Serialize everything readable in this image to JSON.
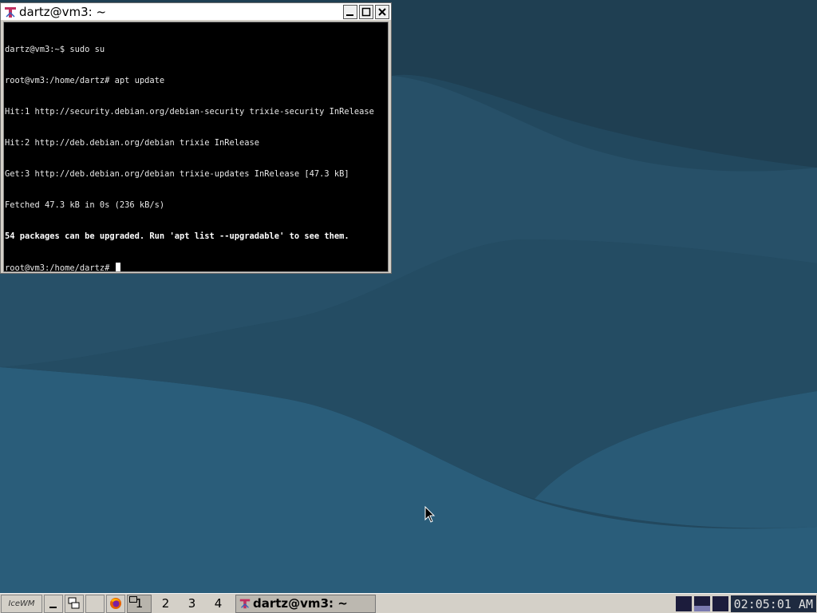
{
  "window": {
    "title": "dartz@vm3: ~"
  },
  "terminal": {
    "lines": [
      {
        "text": "dartz@vm3:~$ sudo su",
        "bold": false
      },
      {
        "text": "root@vm3:/home/dartz# apt update",
        "bold": false
      },
      {
        "text": "Hit:1 http://security.debian.org/debian-security trixie-security InRelease",
        "bold": false
      },
      {
        "text": "Hit:2 http://deb.debian.org/debian trixie InRelease",
        "bold": false
      },
      {
        "text": "Get:3 http://deb.debian.org/debian trixie-updates InRelease [47.3 kB]",
        "bold": false
      },
      {
        "text": "Fetched 47.3 kB in 0s (236 kB/s)",
        "bold": false
      },
      {
        "text": "54 packages can be upgraded. Run 'apt list --upgradable' to see them.",
        "bold": true
      }
    ],
    "prompt": "root@vm3:/home/dartz# "
  },
  "taskbar": {
    "start_label": "IceWM",
    "workspaces": [
      "1",
      "2",
      "3",
      "4"
    ],
    "active_workspace": "1",
    "task_label": "dartz@vm3: ~",
    "clock": "02:05:01 AM",
    "cpu_levels": [
      0,
      0.35,
      0
    ]
  },
  "colors": {
    "desktop": "#2a546b",
    "terminal_bg": "#000000",
    "panel": "#d4d0c8"
  }
}
